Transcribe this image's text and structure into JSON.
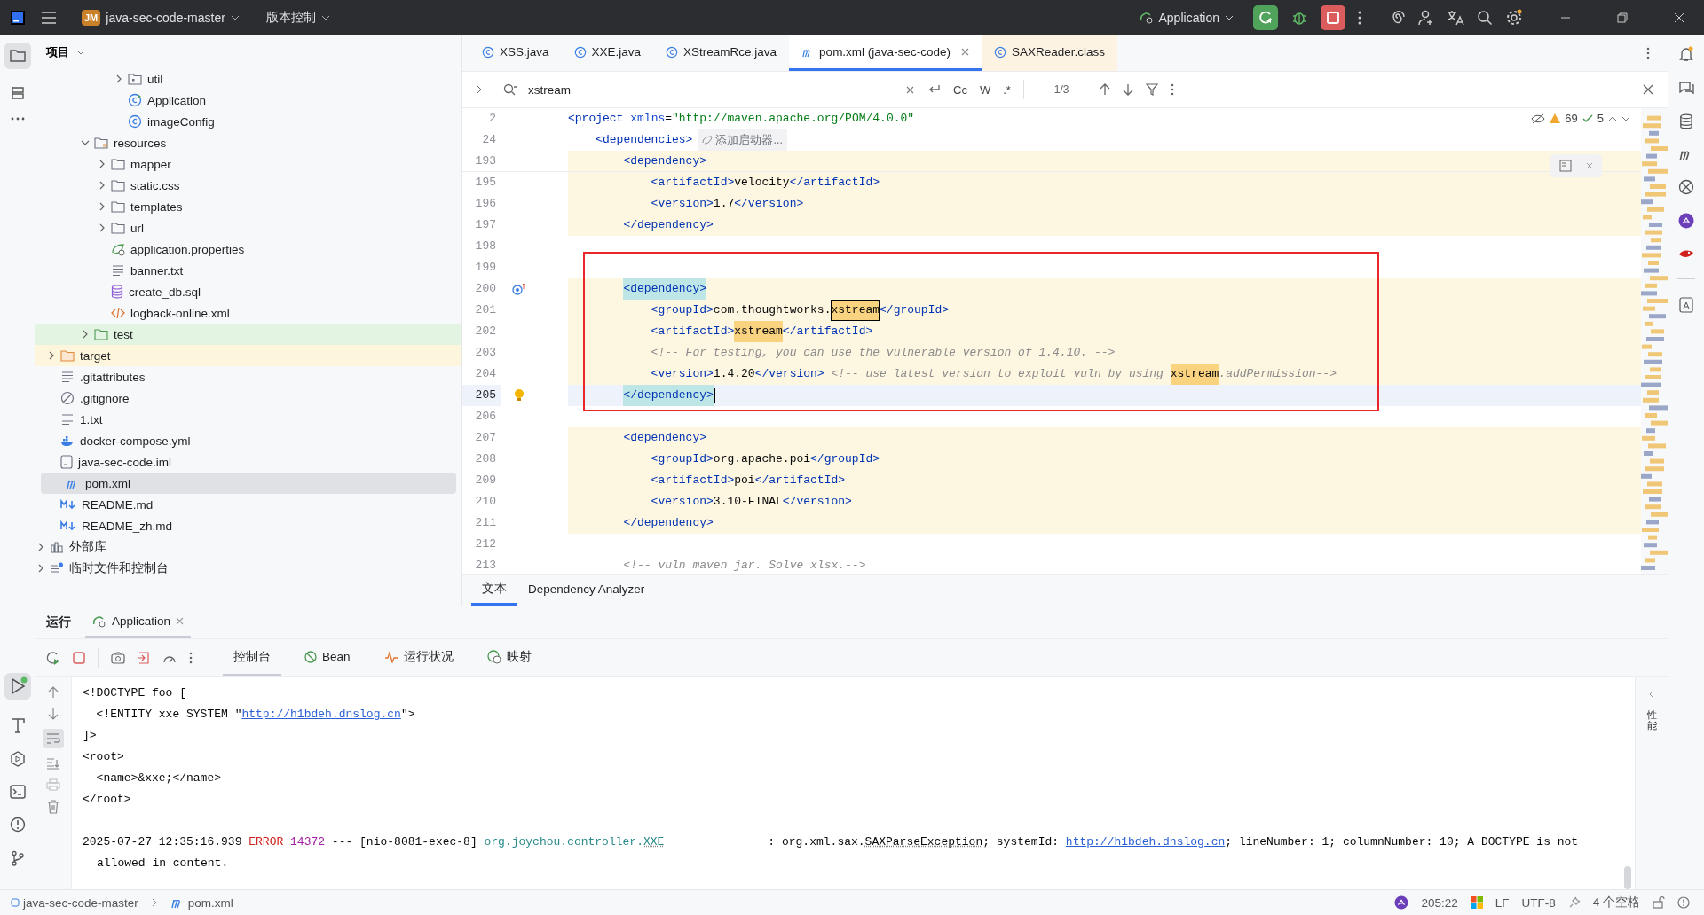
{
  "title_bar": {
    "project_badge": "JM",
    "project": "java-sec-code-master",
    "vcs": "版本控制",
    "run_config": "Application"
  },
  "project_panel": {
    "title": "项目",
    "tree": [
      {
        "children": [
          {
            "children": [
              {
                "children": [
                  {
                    "children": [
                      {
                        "children": [
                          {
                            "label": "util",
                            "kind": "package",
                            "expanded": false,
                            "selected": false
                          },
                          {
                            "label": "Application",
                            "kind": "spring-class",
                            "selected": false
                          },
                          {
                            "label": "imageConfig",
                            "kind": "class",
                            "selected": false
                          }
                        ]
                      }
                    ]
                  },
                  {
                    "label": "resources",
                    "kind": "resources-folder",
                    "expanded": true,
                    "selected": false,
                    "children": [
                      {
                        "label": "mapper",
                        "kind": "folder",
                        "expanded": false,
                        "selected": false
                      },
                      {
                        "label": "static.css",
                        "kind": "folder",
                        "expanded": false,
                        "selected": false
                      },
                      {
                        "label": "templates",
                        "kind": "folder",
                        "expanded": false,
                        "selected": false
                      },
                      {
                        "label": "url",
                        "kind": "folder",
                        "expanded": false,
                        "selected": false
                      },
                      {
                        "label": "application.properties",
                        "kind": "spring-config",
                        "selected": false
                      },
                      {
                        "label": "banner.txt",
                        "kind": "text",
                        "selected": false
                      },
                      {
                        "label": "create_db.sql",
                        "kind": "sql",
                        "selected": false
                      },
                      {
                        "label": "logback-online.xml",
                        "kind": "xml",
                        "selected": false
                      }
                    ]
                  },
                  {
                    "label": "test",
                    "kind": "test-folder",
                    "expanded": false,
                    "selected": false
                  }
                ]
              }
            ]
          },
          {
            "label": "target",
            "kind": "excluded-folder",
            "expanded": false,
            "selected": false
          },
          {
            "label": ".gitattributes",
            "kind": "text",
            "selected": false
          },
          {
            "label": ".gitignore",
            "kind": "ignore",
            "selected": false
          },
          {
            "label": "1.txt",
            "kind": "text",
            "selected": false
          },
          {
            "label": "docker-compose.yml",
            "kind": "docker",
            "selected": false
          },
          {
            "label": "java-sec-code.iml",
            "kind": "iml",
            "selected": false
          },
          {
            "label": "pom.xml",
            "kind": "maven",
            "selected": true
          },
          {
            "label": "README.md",
            "kind": "markdown",
            "selected": false
          },
          {
            "label": "README_zh.md",
            "kind": "markdown",
            "selected": false
          }
        ]
      },
      {
        "label": "外部库",
        "kind": "library",
        "expanded": false,
        "selected": false
      },
      {
        "label": "临时文件和控制台",
        "kind": "scratch",
        "expanded": false,
        "selected": false
      }
    ]
  },
  "editor": {
    "tabs": [
      {
        "label": "XSS.java",
        "kind": "java",
        "selected": false
      },
      {
        "label": "XXE.java",
        "kind": "java",
        "selected": false
      },
      {
        "label": "XStreamRce.java",
        "kind": "java",
        "selected": false
      },
      {
        "label": "pom.xml (java-sec-code)",
        "kind": "maven",
        "selected": true
      },
      {
        "label": "SAXReader.class",
        "kind": "class",
        "selected": false
      }
    ],
    "search": {
      "value": "xstream",
      "match_count": "1/3",
      "options": [
        "Cc",
        "W",
        ".*"
      ]
    },
    "inspections": {
      "warnings": "69",
      "passed": "5"
    },
    "lines": [
      {
        "number": "2",
        "kind": "plain",
        "band": false,
        "current": false,
        "segments": [
          {
            "kind": "tag",
            "text": "<project"
          },
          {
            "kind": "attr",
            "text": " xmlns"
          },
          {
            "kind": "plain",
            "text": "="
          },
          {
            "kind": "string",
            "text": "\"http://maven.apache.org/POM/4.0.0\""
          }
        ]
      },
      {
        "number": "24",
        "kind": "plain",
        "band": false,
        "current": false,
        "hint": "添加启动器...",
        "segments": [
          {
            "kind": "tag",
            "text": "    <dependencies>"
          }
        ]
      },
      {
        "number": "193",
        "kind": "plain",
        "band": true,
        "current": false,
        "segments": [
          {
            "kind": "tag",
            "text": "        <dependency>"
          }
        ]
      },
      {
        "number": "195",
        "kind": "plain",
        "band": true,
        "current": false,
        "segments": [
          {
            "kind": "tag",
            "text": "            <artifactId>"
          },
          {
            "kind": "plain",
            "text": "velocity"
          },
          {
            "kind": "tag",
            "text": "</artifactId>"
          }
        ]
      },
      {
        "number": "196",
        "kind": "plain",
        "band": true,
        "current": false,
        "segments": [
          {
            "kind": "tag",
            "text": "            <version>"
          },
          {
            "kind": "plain",
            "text": "1.7"
          },
          {
            "kind": "tag",
            "text": "</version>"
          }
        ]
      },
      {
        "number": "197",
        "kind": "plain",
        "band": true,
        "current": false,
        "segments": [
          {
            "kind": "tag",
            "text": "        </dependency>"
          }
        ]
      },
      {
        "number": "198",
        "kind": "plain"
      },
      {
        "number": "199",
        "kind": "plain"
      },
      {
        "number": "200",
        "kind": "implemented",
        "band": true,
        "current": false,
        "segments": [
          {
            "kind": "pair",
            "text": "        <dependency>"
          }
        ]
      },
      {
        "number": "201",
        "kind": "plain",
        "band": true,
        "current": false,
        "segments": [
          {
            "kind": "tag",
            "text": "            <groupId>"
          },
          {
            "kind": "plain",
            "text": "com.thoughtworks."
          },
          {
            "kind": "match_current",
            "text": "xstream"
          },
          {
            "kind": "tag",
            "text": "</groupId>"
          }
        ]
      },
      {
        "number": "202",
        "kind": "plain",
        "band": true,
        "current": false,
        "segments": [
          {
            "kind": "tag",
            "text": "            <artifactId>"
          },
          {
            "kind": "match",
            "text": "xstream"
          },
          {
            "kind": "tag",
            "text": "</artifactId>"
          }
        ]
      },
      {
        "number": "203",
        "kind": "plain",
        "band": true,
        "current": false,
        "segments": [
          {
            "kind": "comment",
            "text": "            <!-- For testing, you can use the vulnerable version of 1.4.10. -->"
          }
        ]
      },
      {
        "number": "204",
        "kind": "plain",
        "band": true,
        "current": false,
        "segments": [
          {
            "kind": "tag",
            "text": "            <version>"
          },
          {
            "kind": "plain",
            "text": "1.4.20"
          },
          {
            "kind": "tag",
            "text": "</version>"
          },
          {
            "kind": "comment",
            "text": " <!-- use latest version to exploit vuln by using "
          },
          {
            "kind": "match",
            "text": "xstream"
          },
          {
            "kind": "comment",
            "text": ".addPermission-->"
          }
        ]
      },
      {
        "number": "205",
        "kind": "bulb",
        "band": false,
        "current": true,
        "segments": [
          {
            "kind": "pair",
            "text": "        </dependency>"
          }
        ]
      },
      {
        "number": "206",
        "kind": "plain"
      },
      {
        "number": "207",
        "kind": "plain",
        "band": true,
        "current": false,
        "segments": [
          {
            "kind": "tag",
            "text": "        <dependency>"
          }
        ]
      },
      {
        "number": "208",
        "kind": "plain",
        "band": true,
        "current": false,
        "segments": [
          {
            "kind": "tag",
            "text": "            <groupId>"
          },
          {
            "kind": "plain",
            "text": "org.apache.poi"
          },
          {
            "kind": "tag",
            "text": "</groupId>"
          }
        ]
      },
      {
        "number": "209",
        "kind": "plain",
        "band": true,
        "current": false,
        "segments": [
          {
            "kind": "tag",
            "text": "            <artifactId>"
          },
          {
            "kind": "plain",
            "text": "poi"
          },
          {
            "kind": "tag",
            "text": "</artifactId>"
          }
        ]
      },
      {
        "number": "210",
        "kind": "plain",
        "band": true,
        "current": false,
        "segments": [
          {
            "kind": "tag",
            "text": "            <version>"
          },
          {
            "kind": "plain",
            "text": "3.10-FINAL"
          },
          {
            "kind": "tag",
            "text": "</version>"
          }
        ]
      },
      {
        "number": "211",
        "kind": "plain",
        "band": true,
        "current": false,
        "segments": [
          {
            "kind": "tag",
            "text": "        </dependency>"
          }
        ]
      },
      {
        "number": "212",
        "kind": "plain"
      },
      {
        "number": "213",
        "kind": "plain",
        "band": false,
        "current": false,
        "segments": [
          {
            "kind": "comment",
            "text": "        <!-- vuln maven jar. Solve xlsx.-->"
          }
        ]
      }
    ],
    "bottom_tabs": [
      {
        "label": "文本",
        "selected": true
      },
      {
        "label": "Dependency Analyzer",
        "selected": false
      }
    ]
  },
  "run_panel": {
    "title": "运行",
    "tabs": [
      {
        "label": "Application",
        "selected": true
      }
    ],
    "tool_tabs": [
      {
        "label": "控制台",
        "kind": "console",
        "selected": true
      },
      {
        "label": "Bean",
        "kind": "bean",
        "selected": false
      },
      {
        "label": "运行状况",
        "kind": "health",
        "selected": false
      },
      {
        "label": "映射",
        "kind": "mapping",
        "selected": false
      }
    ],
    "console": [
      {
        "kind": "line",
        "segments": [
          {
            "kind": "plain",
            "text": "<!DOCTYPE foo ["
          }
        ]
      },
      {
        "kind": "line",
        "segments": [
          {
            "kind": "plain",
            "text": "  <!ENTITY xxe SYSTEM \""
          },
          {
            "kind": "link",
            "text": "http://h1bdeh.dnslog.cn"
          },
          {
            "kind": "plain",
            "text": "\">"
          }
        ]
      },
      {
        "kind": "line",
        "segments": [
          {
            "kind": "plain",
            "text": "]>"
          }
        ]
      },
      {
        "kind": "line",
        "segments": [
          {
            "kind": "plain",
            "text": "<root>"
          }
        ]
      },
      {
        "kind": "line",
        "segments": [
          {
            "kind": "plain",
            "text": "  <name>&xxe;</name>"
          }
        ]
      },
      {
        "kind": "line",
        "segments": [
          {
            "kind": "plain",
            "text": "</root>"
          }
        ]
      },
      {
        "kind": "line"
      },
      {
        "kind": "line",
        "segments": [
          {
            "kind": "plain",
            "text": "2025-07-27 12:35:16.939 "
          },
          {
            "kind": "error",
            "text": "ERROR "
          },
          {
            "kind": "pid",
            "text": "14372"
          },
          {
            "kind": "plain",
            "text": " --- [nio-8081-exec-8] "
          },
          {
            "kind": "logger",
            "text": "org.joychou.controller."
          },
          {
            "kind": "logger_ref",
            "text": "XXE"
          },
          {
            "kind": "plain",
            "text": "               : org.xml.sax."
          },
          {
            "kind": "ref",
            "text": "SAXParseException"
          },
          {
            "kind": "plain",
            "text": "; systemId: "
          },
          {
            "kind": "link",
            "text": "http://h1bdeh.dnslog.cn"
          },
          {
            "kind": "plain",
            "text": "; lineNumber: 1; columnNumber: 10; A DOCTYPE is not"
          }
        ]
      },
      {
        "kind": "wrap",
        "segments": [
          {
            "kind": "plain",
            "text": "allowed in content."
          }
        ]
      }
    ],
    "side_label": "性能"
  },
  "status_bar": {
    "breadcrumbs": [
      {
        "label": "java-sec-code-master",
        "kind": "module"
      },
      {
        "label": "pom.xml",
        "kind": "maven"
      }
    ],
    "position": "205:22",
    "line_separator": "LF",
    "encoding": "UTF-8",
    "indent": "4 个空格"
  }
}
